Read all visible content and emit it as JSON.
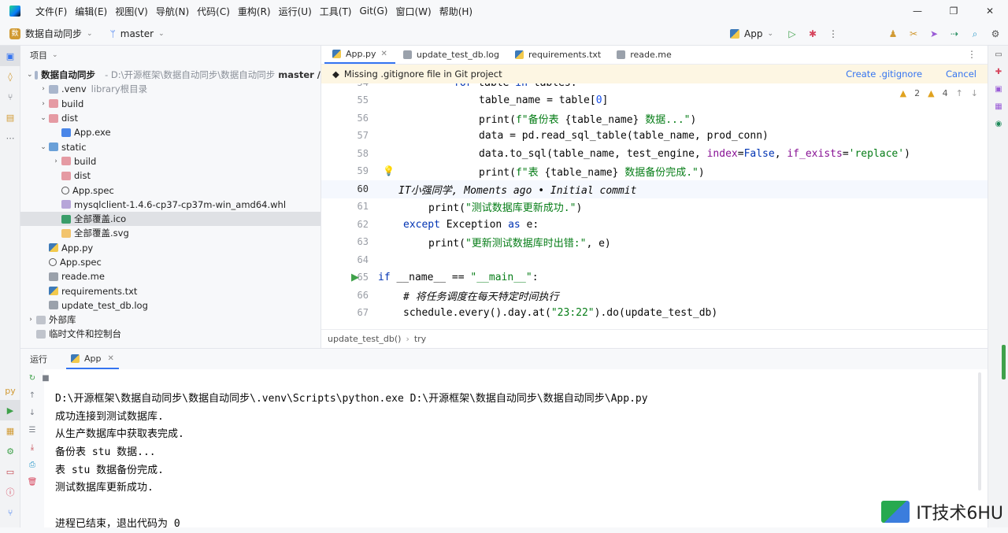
{
  "menubar": {
    "items": [
      "文件(F)",
      "编辑(E)",
      "视图(V)",
      "导航(N)",
      "代码(C)",
      "重构(R)",
      "运行(U)",
      "工具(T)",
      "Git(G)",
      "窗口(W)",
      "帮助(H)"
    ]
  },
  "toolbar": {
    "project_name": "数据自动同步",
    "branch": "master",
    "run_config": "App"
  },
  "project_panel": {
    "title": "项目",
    "root_name": "数据自动同步",
    "root_path": "D:\\开源框架\\数据自动同步\\数据自动同步",
    "root_branch": "master /",
    "items": [
      {
        "label": "数据自动同步",
        "indent": 0,
        "arrow": "⌄",
        "icon": "folder"
      },
      {
        "label": ".venv",
        "extra": "library根目录",
        "indent": 1,
        "arrow": "›",
        "icon": "folder"
      },
      {
        "label": "build",
        "indent": 1,
        "arrow": "›",
        "icon": "folderr"
      },
      {
        "label": "dist",
        "indent": 1,
        "arrow": "⌄",
        "icon": "folderr"
      },
      {
        "label": "App.exe",
        "indent": 2,
        "arrow": "",
        "icon": "exe"
      },
      {
        "label": "static",
        "indent": 1,
        "arrow": "⌄",
        "icon": "folderb"
      },
      {
        "label": "build",
        "indent": 2,
        "arrow": "›",
        "icon": "folderr"
      },
      {
        "label": "dist",
        "indent": 2,
        "arrow": "",
        "icon": "folderr"
      },
      {
        "label": "App.spec",
        "indent": 2,
        "arrow": "",
        "icon": "spec"
      },
      {
        "label": "mysqlclient-1.4.6-cp37-cp37m-win_amd64.whl",
        "indent": 2,
        "arrow": "",
        "icon": "whl"
      },
      {
        "label": "全部覆盖.ico",
        "indent": 2,
        "arrow": "",
        "icon": "ico",
        "selected": true
      },
      {
        "label": "全部覆盖.svg",
        "indent": 2,
        "arrow": "",
        "icon": "svg"
      },
      {
        "label": "App.py",
        "indent": 1,
        "arrow": "",
        "icon": "py"
      },
      {
        "label": "App.spec",
        "indent": 1,
        "arrow": "",
        "icon": "spec"
      },
      {
        "label": "reade.me",
        "indent": 1,
        "arrow": "",
        "icon": "txt"
      },
      {
        "label": "requirements.txt",
        "indent": 1,
        "arrow": "",
        "icon": "py"
      },
      {
        "label": "update_test_db.log",
        "indent": 1,
        "arrow": "",
        "icon": "txt"
      },
      {
        "label": "外部库",
        "indent": 0,
        "arrow": "›",
        "icon": "ext"
      },
      {
        "label": "临时文件和控制台",
        "indent": 0,
        "arrow": "",
        "icon": "ext"
      }
    ]
  },
  "editor": {
    "tabs": [
      "App.py",
      "update_test_db.log",
      "requirements.txt",
      "reade.me"
    ],
    "banner": {
      "text": "Missing .gitignore file in Git project",
      "create": "Create .gitignore",
      "cancel": "Cancel"
    },
    "inspections": {
      "warnings": "2",
      "weak": "4"
    },
    "blame": "IT小强同学, Moments ago • Initial commit",
    "breadcrumb": [
      "update_test_db()",
      "try"
    ]
  },
  "run_panel": {
    "label": "运行",
    "tab": "App",
    "output": [
      "D:\\开源框架\\数据自动同步\\数据自动同步\\.venv\\Scripts\\python.exe D:\\开源框架\\数据自动同步\\数据自动同步\\App.py",
      "成功连接到测试数据库.",
      "从生产数据库中获取表完成.",
      "备份表 stu 数据...",
      "表 stu 数据备份完成.",
      "测试数据库更新成功.",
      "",
      "进程已结束，退出代码为 0"
    ]
  },
  "watermark": "IT技术6HU"
}
